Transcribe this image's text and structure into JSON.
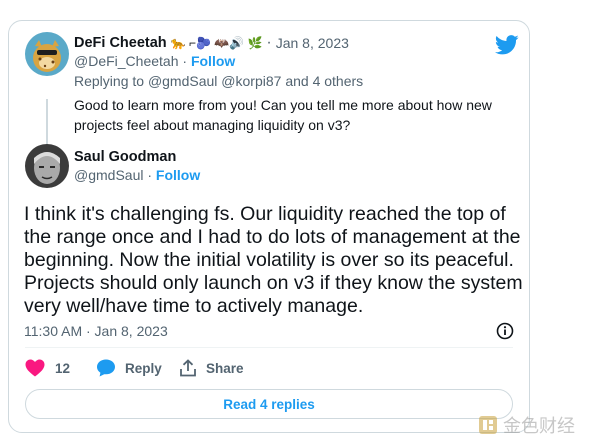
{
  "tweet_parent": {
    "author_name": "DeFi Cheetah",
    "author_emojis": "🐆 ⌐🫐 🦇🔊 🌿",
    "handle": "@DeFi_Cheetah",
    "follow_label": "Follow",
    "date": "Jan 8, 2023",
    "replying_prefix": "Replying to",
    "replying_to": "@gmdSaul @korpi87",
    "replying_suffix": "and 4 others",
    "text": "Good to learn more from you! Can you tell me more about how new projects feel about managing liquidity on v3?"
  },
  "tweet_main": {
    "author_name": "Saul Goodman",
    "handle": "@gmdSaul",
    "follow_label": "Follow",
    "text": "I think it's challenging fs. Our liquidity reached the top of the range once and I had to do lots of management at the beginning. Now the initial volatility is over so its peaceful. Projects should only launch on v3 if they know the system very well/have time to actively manage.",
    "timestamp": "11:30 AM · Jan 8, 2023"
  },
  "actions": {
    "likes": "12",
    "reply_label": "Reply",
    "share_label": "Share"
  },
  "read_replies_label": "Read 4 replies",
  "watermark": "金色财经",
  "colors": {
    "accent": "#1d9bf0",
    "like": "#f91880",
    "muted": "#536471"
  }
}
